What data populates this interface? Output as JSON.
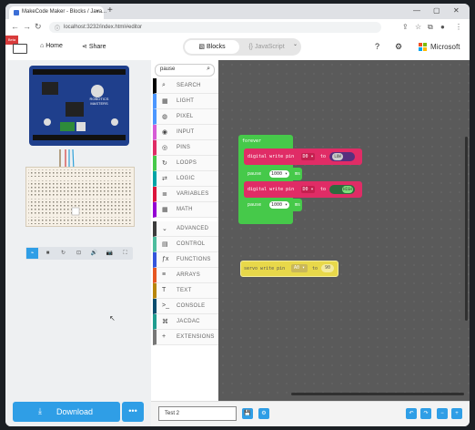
{
  "browser": {
    "tab_title": "MakeCode Maker - Blocks / Java...",
    "tab_close": "×",
    "new_tab": "+",
    "url": "localhost:3232/index.html#editor",
    "window_controls": [
      "—",
      "▢",
      "✕"
    ]
  },
  "header": {
    "beta_label": "Beta",
    "home_label": "Home",
    "share_label": "Share",
    "blocks_label": "Blocks",
    "javascript_label": "JavaScript",
    "brand_label": "Microsoft"
  },
  "colors": {
    "accent": "#2f9ee6",
    "workspace_bg": "#5a5a5a",
    "loops_green": "#46c94a",
    "pins_pink": "#e02c66",
    "servo_yellow": "#e8d84a"
  },
  "toolbox": {
    "search_value": "pause",
    "categories": [
      {
        "label": "SEARCH",
        "icon": "⌕",
        "color": "#000000"
      },
      {
        "label": "LIGHT",
        "icon": "▦",
        "color": "#4c97ff"
      },
      {
        "label": "PIXEL",
        "icon": "◍",
        "color": "#4c97ff"
      },
      {
        "label": "INPUT",
        "icon": "◉",
        "color": "#d65cd6"
      },
      {
        "label": "PINS",
        "icon": "◎",
        "color": "#e02c66"
      },
      {
        "label": "LOOPS",
        "icon": "↻",
        "color": "#46c94a"
      },
      {
        "label": "LOGIC",
        "icon": "⇄",
        "color": "#00a4a6"
      },
      {
        "label": "VARIABLES",
        "icon": "≣",
        "color": "#dc143c"
      },
      {
        "label": "MATH",
        "icon": "▦",
        "color": "#9400d3"
      },
      {
        "label": "ADVANCED",
        "icon": "⌄",
        "color": "#3c3c3c"
      },
      {
        "label": "CONTROL",
        "icon": "▤",
        "color": "#4dbd9e"
      },
      {
        "label": "FUNCTIONS",
        "icon": "ƒx",
        "color": "#3455db"
      },
      {
        "label": "ARRAYS",
        "icon": "≡",
        "color": "#e65722"
      },
      {
        "label": "TEXT",
        "icon": "T",
        "color": "#b8860b"
      },
      {
        "label": "CONSOLE",
        "icon": ">_",
        "color": "#0c4e6f"
      },
      {
        "label": "JACDAC",
        "icon": "⌘",
        "color": "#1f9d8f"
      },
      {
        "label": "EXTENSIONS",
        "icon": "+",
        "color": "#777777"
      }
    ]
  },
  "workspace": {
    "forever_label": "forever",
    "blocks": [
      {
        "type": "digital write",
        "text": "digital write pin",
        "pin": "D0 ▾",
        "to": "to",
        "value": "LOW"
      },
      {
        "type": "pause",
        "text": "pause",
        "value": "1000 ▾",
        "unit": "ms"
      },
      {
        "type": "digital write",
        "text": "digital write pin",
        "pin": "D0 ▾",
        "to": "to",
        "value": "HIGH"
      },
      {
        "type": "pause",
        "text": "pause",
        "value": "1000 ▾",
        "unit": "ms"
      }
    ],
    "servo": {
      "text": "servo write pin",
      "pin": "A0 ▾",
      "to": "to",
      "value": "90"
    }
  },
  "simulator": {
    "board_label": "ROBOTICS MASTERS",
    "tools": [
      "⌁",
      "■",
      "↻",
      "⊡",
      "🔊",
      "📷",
      "⛶"
    ]
  },
  "footer": {
    "download_label": "Download",
    "download_more": "•••",
    "project_name": "Test 2",
    "buttons": [
      "💾",
      "⚙",
      "↶",
      "↷",
      "−",
      "+"
    ]
  }
}
